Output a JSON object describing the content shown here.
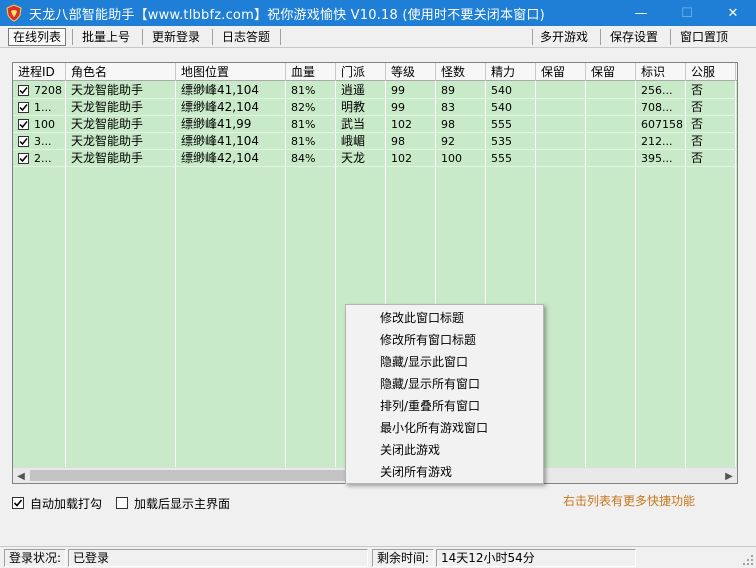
{
  "window": {
    "title": "天龙八部智能助手【www.tlbbfz.com】祝你游戏愉快 V10.18 (使用时不要关闭本窗口)",
    "controls": [
      "—",
      "☐",
      "✕"
    ]
  },
  "menu": {
    "left": [
      "在线列表",
      "批量上号",
      "更新登录",
      "日志答题"
    ],
    "right": [
      "多开游戏",
      "保存设置",
      "窗口置顶"
    ],
    "active": "在线列表"
  },
  "table": {
    "headers": [
      "进程ID",
      "角色名",
      "地图位置",
      "血量",
      "门派",
      "等级",
      "怪数",
      "精力",
      "保留",
      "保留",
      "标识",
      "公服"
    ],
    "rows": [
      {
        "checked": true,
        "pid": "7208",
        "name": "天龙智能助手",
        "map": "缥缈峰41,104",
        "hp": "81%",
        "sect": "逍遥",
        "level": "99",
        "mobs": "89",
        "energy": "540",
        "r1": "",
        "r2": "",
        "tag": "256...",
        "pub": "否"
      },
      {
        "checked": true,
        "pid": "1...",
        "name": "天龙智能助手",
        "map": "缥缈峰42,104",
        "hp": "82%",
        "sect": "明教",
        "level": "99",
        "mobs": "83",
        "energy": "540",
        "r1": "",
        "r2": "",
        "tag": "708...",
        "pub": "否"
      },
      {
        "checked": true,
        "pid": "100",
        "name": "天龙智能助手",
        "map": "缥缈峰41,99",
        "hp": "81%",
        "sect": "武当",
        "level": "102",
        "mobs": "98",
        "energy": "555",
        "r1": "",
        "r2": "",
        "tag": "607158",
        "pub": "否"
      },
      {
        "checked": true,
        "pid": "3...",
        "name": "天龙智能助手",
        "map": "缥缈峰41,104",
        "hp": "81%",
        "sect": "峨嵋",
        "level": "98",
        "mobs": "92",
        "energy": "535",
        "r1": "",
        "r2": "",
        "tag": "212...",
        "pub": "否"
      },
      {
        "checked": true,
        "pid": "2...",
        "name": "天龙智能助手",
        "map": "缥缈峰42,104",
        "hp": "84%",
        "sect": "天龙",
        "level": "102",
        "mobs": "100",
        "energy": "555",
        "r1": "",
        "r2": "",
        "tag": "395...",
        "pub": "否"
      }
    ]
  },
  "context_menu": [
    "修改此窗口标题",
    "修改所有窗口标题",
    "隐藏/显示此窗口",
    "隐藏/显示所有窗口",
    "排列/重叠所有窗口",
    "最小化所有游戏窗口",
    "关闭此游戏",
    "关闭所有游戏"
  ],
  "options": {
    "auto_load": {
      "label": "自动加载打勾",
      "checked": true
    },
    "show_main": {
      "label": "加载后显示主界面",
      "checked": false
    },
    "hint": "右击列表有更多快捷功能"
  },
  "status": {
    "login_label": "登录状况:",
    "login_value": "已登录",
    "remain_label": "剩余时间:",
    "remain_value": "14天12小时54分"
  },
  "colors": {
    "titlebar": "#1f7fd6",
    "grid_bg": "#c9eac9",
    "hint": "#c8771d"
  }
}
